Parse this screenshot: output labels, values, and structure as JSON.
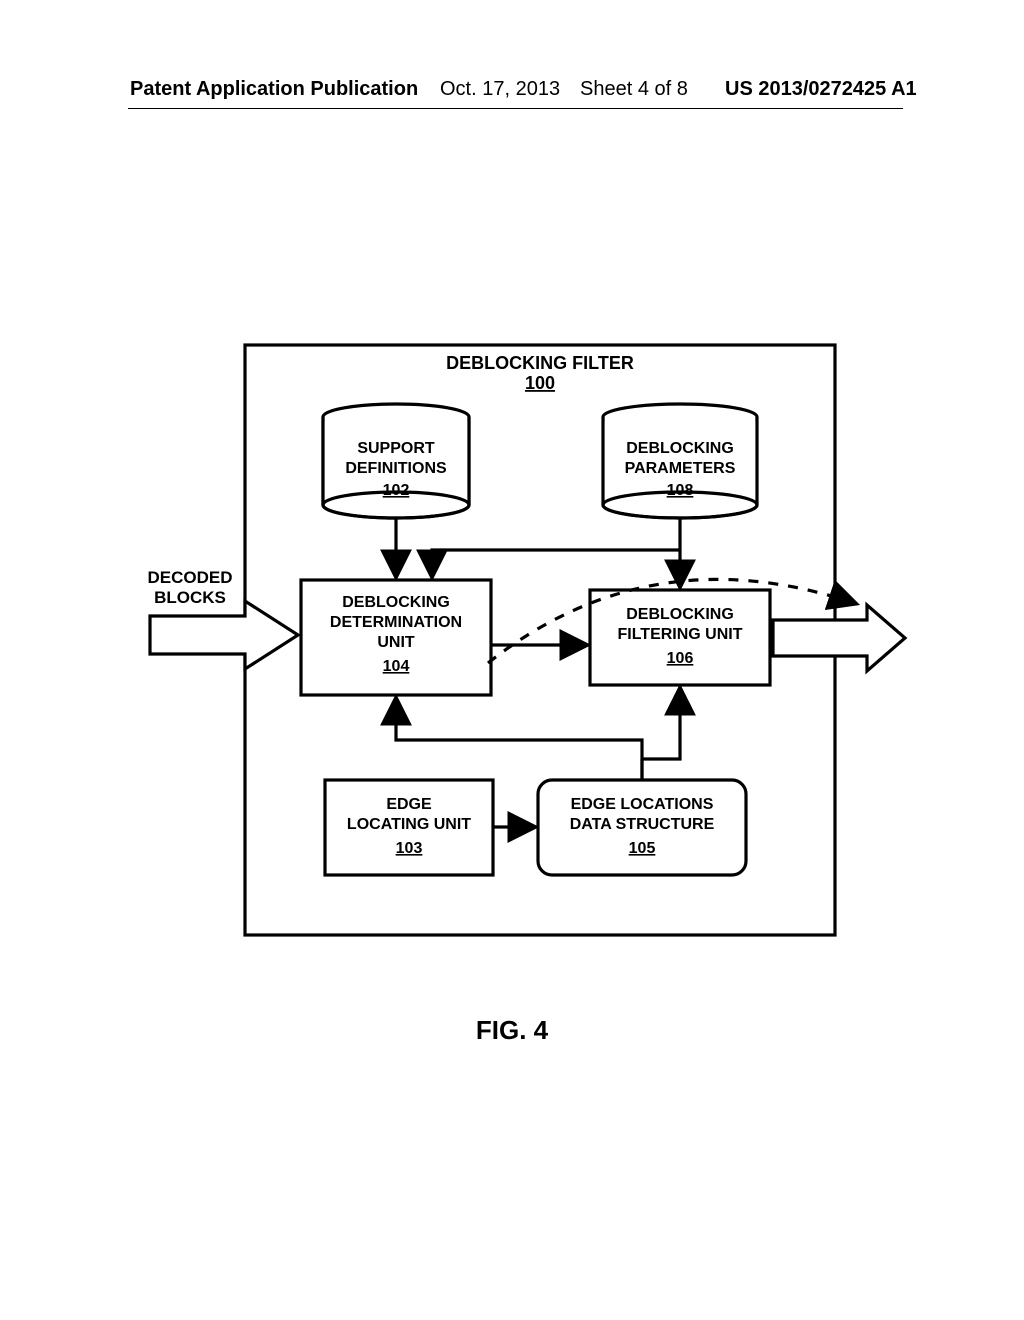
{
  "header": {
    "pub_type": "Patent Application Publication",
    "date": "Oct. 17, 2013",
    "sheet": "Sheet 4 of 8",
    "pub_num": "US 2013/0272425 A1"
  },
  "diagram": {
    "title": "DEBLOCKING FILTER",
    "title_ref": "100",
    "support": {
      "label": "SUPPORT DEFINITIONS",
      "ref": "102"
    },
    "params": {
      "label": "DEBLOCKING PARAMETERS",
      "ref": "108"
    },
    "determ": {
      "label": "DEBLOCKING DETERMINATION UNIT",
      "ref": "104"
    },
    "filt": {
      "label": "DEBLOCKING FILTERING UNIT",
      "ref": "106"
    },
    "elu": {
      "label": "EDGE LOCATING UNIT",
      "ref": "103"
    },
    "elds": {
      "label": "EDGE LOCATIONS DATA STRUCTURE",
      "ref": "105"
    },
    "in": "DECODED BLOCKS"
  },
  "figure_caption": "FIG. 4"
}
